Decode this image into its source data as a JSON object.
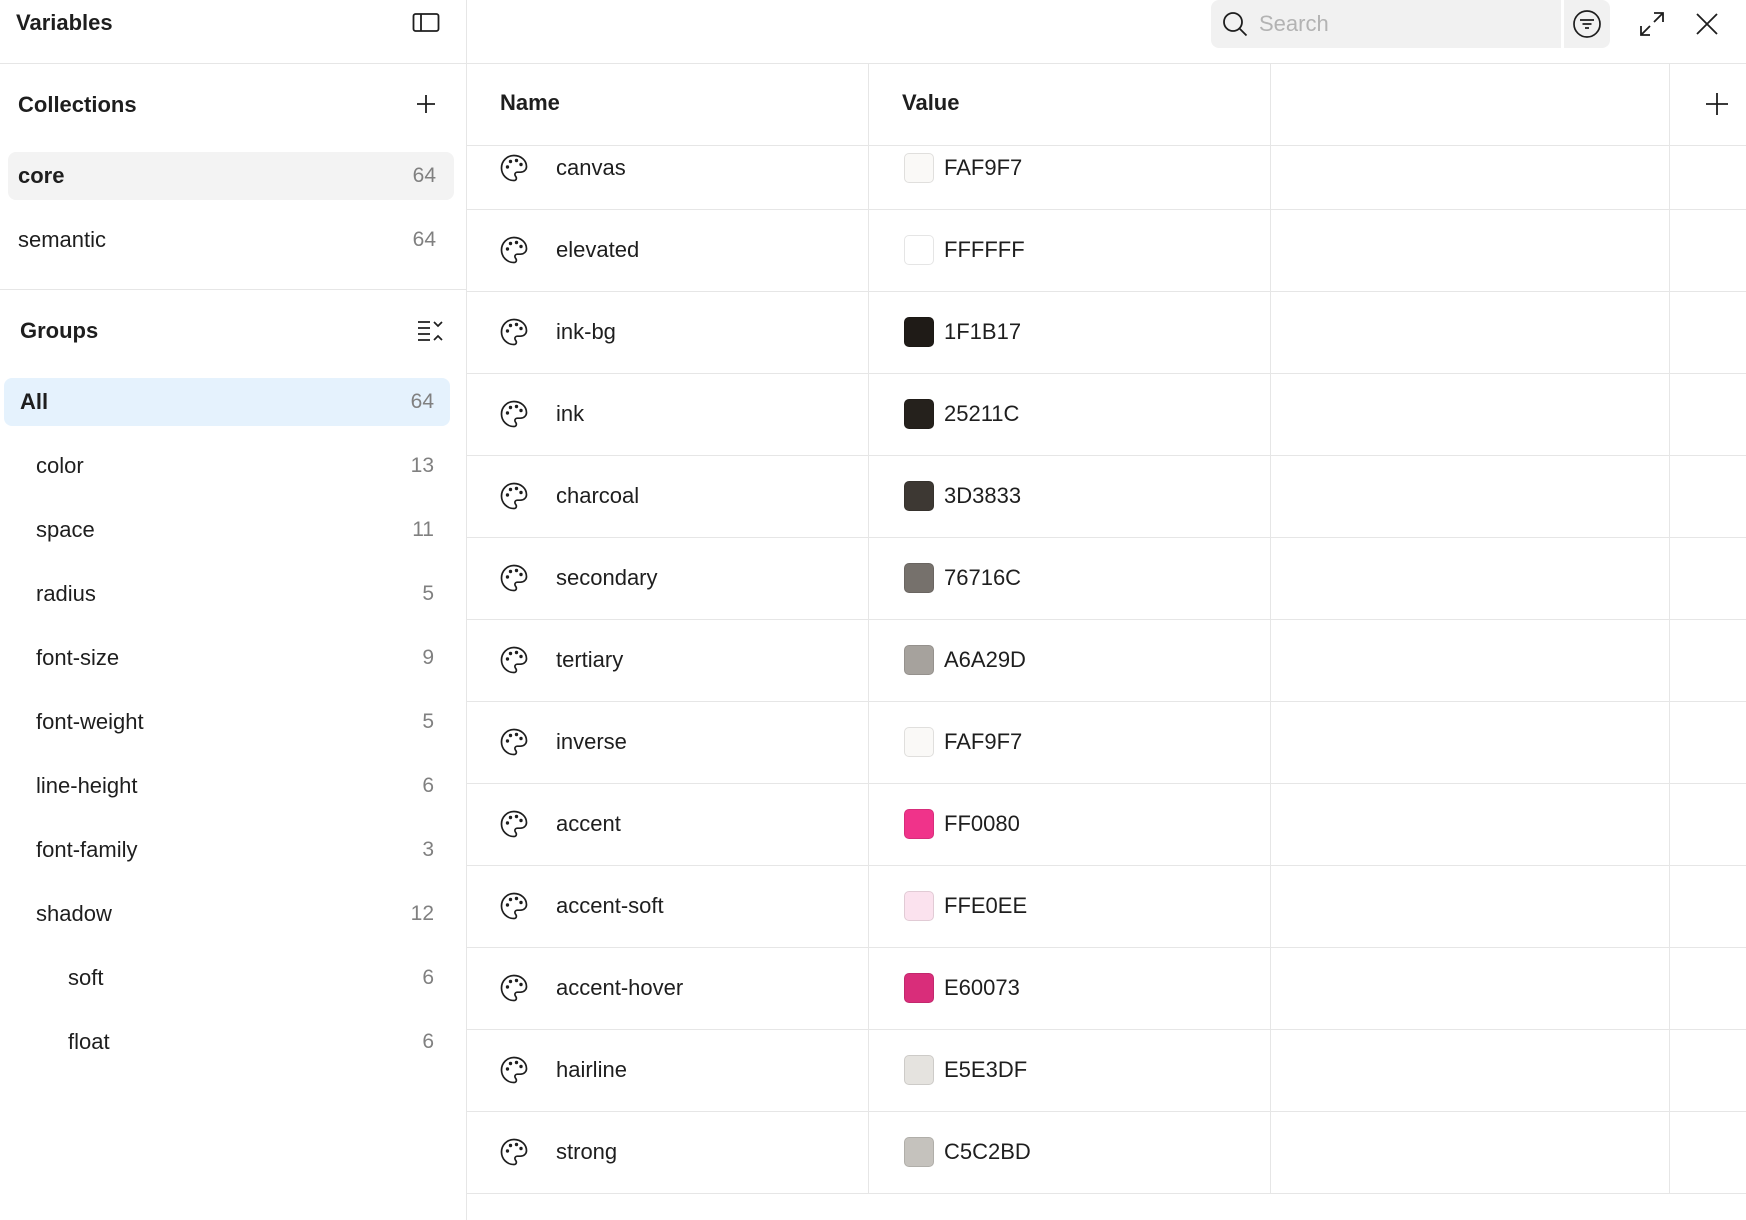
{
  "sidebar": {
    "title": "Variables",
    "collections": {
      "title": "Collections",
      "items": [
        {
          "label": "core",
          "count": "64"
        },
        {
          "label": "semantic",
          "count": "64"
        }
      ]
    },
    "groups": {
      "title": "Groups",
      "items": [
        {
          "label": "All",
          "count": "64"
        },
        {
          "label": "color",
          "count": "13"
        },
        {
          "label": "space",
          "count": "11"
        },
        {
          "label": "radius",
          "count": "5"
        },
        {
          "label": "font-size",
          "count": "9"
        },
        {
          "label": "font-weight",
          "count": "5"
        },
        {
          "label": "line-height",
          "count": "6"
        },
        {
          "label": "font-family",
          "count": "3"
        },
        {
          "label": "shadow",
          "count": "12"
        },
        {
          "label": "soft",
          "count": "6"
        },
        {
          "label": "float",
          "count": "6"
        }
      ]
    }
  },
  "search": {
    "placeholder": "Search",
    "value": ""
  },
  "table": {
    "columns": {
      "name": "Name",
      "value": "Value"
    },
    "rows": [
      {
        "name": "canvas",
        "value": "FAF9F7",
        "color": "#FAF9F7"
      },
      {
        "name": "elevated",
        "value": "FFFFFF",
        "color": "#FFFFFF"
      },
      {
        "name": "ink-bg",
        "value": "1F1B17",
        "color": "#1F1B17"
      },
      {
        "name": "ink",
        "value": "25211C",
        "color": "#25211C"
      },
      {
        "name": "charcoal",
        "value": "3D3833",
        "color": "#3D3833"
      },
      {
        "name": "secondary",
        "value": "76716C",
        "color": "#76716C"
      },
      {
        "name": "tertiary",
        "value": "A6A29D",
        "color": "#A6A29D"
      },
      {
        "name": "inverse",
        "value": "FAF9F7",
        "color": "#FAF9F7"
      },
      {
        "name": "accent",
        "value": "FF0080",
        "color": "#F0338A"
      },
      {
        "name": "accent-soft",
        "value": "FFE0EE",
        "color": "#FBE2EE"
      },
      {
        "name": "accent-hover",
        "value": "E60073",
        "color": "#D92D7A"
      },
      {
        "name": "hairline",
        "value": "E5E3DF",
        "color": "#E5E3DF"
      },
      {
        "name": "strong",
        "value": "C5C2BD",
        "color": "#C5C2BD"
      }
    ]
  },
  "icons": {
    "sidebar_toggle": "sidebar-panel-icon",
    "add": "plus-icon",
    "group_collapse": "collapse-list-icon",
    "search": "search-icon",
    "filter": "filter-icon",
    "expand": "expand-icon",
    "close": "close-icon",
    "row_type": "palette-icon"
  },
  "colors": {
    "selected_collection_bg": "#F3F3F3",
    "selected_group_bg": "#E5F2FD",
    "divider": "#E6E6E6"
  }
}
